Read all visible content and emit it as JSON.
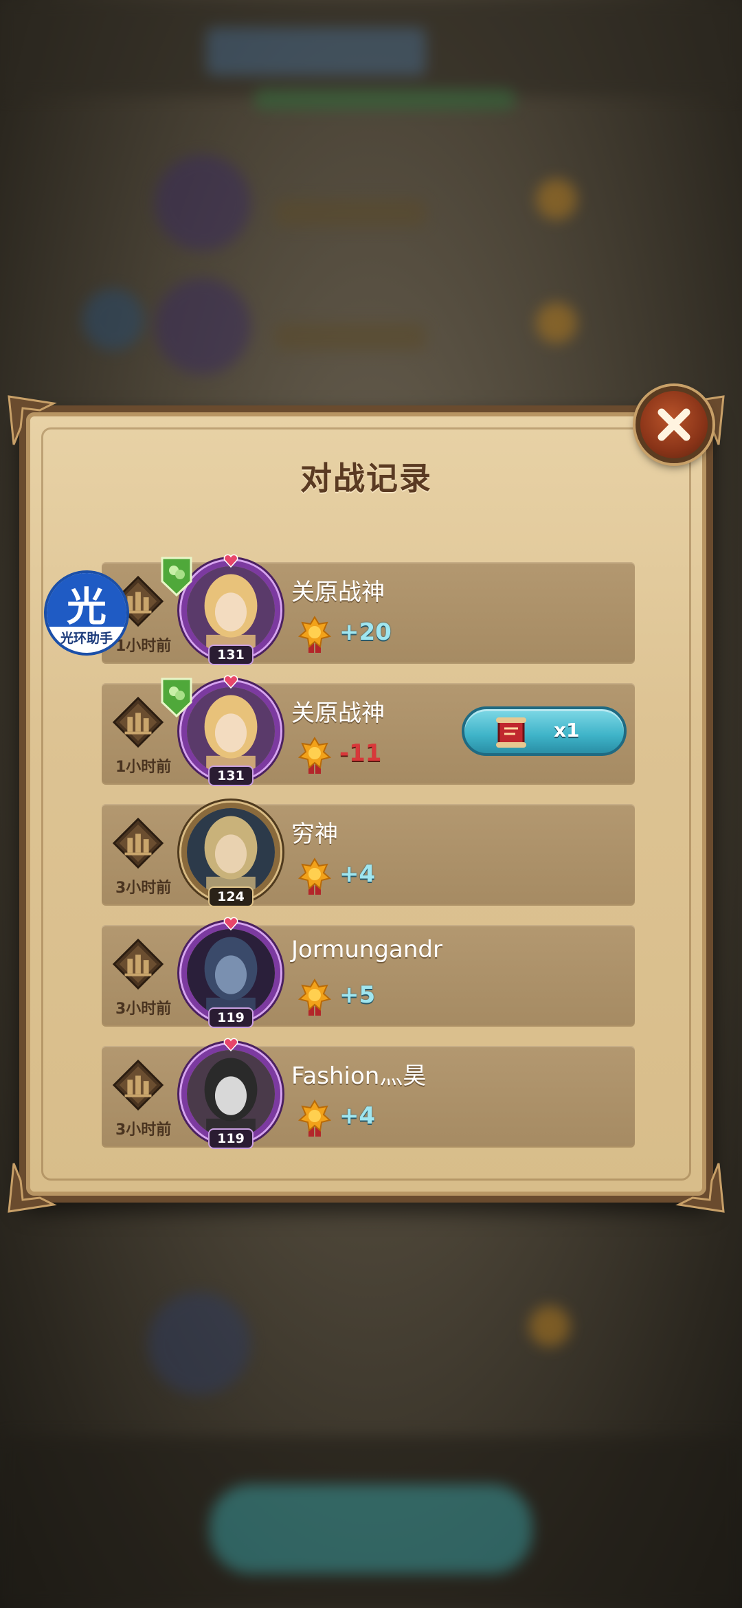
{
  "panel": {
    "title": "对战记录"
  },
  "records": [
    {
      "name": "关原战神",
      "score": "+20",
      "score_type": "positive",
      "time": "1小时前",
      "level": "131",
      "frame": "purple",
      "shield": true
    },
    {
      "name": "关原战神",
      "score": "-11",
      "score_type": "negative",
      "time": "1小时前",
      "level": "131",
      "frame": "purple",
      "shield": true,
      "item_count": "x1"
    },
    {
      "name": "穷神",
      "score": "+4",
      "score_type": "positive",
      "time": "3小时前",
      "level": "124",
      "frame": "brown",
      "shield": false
    },
    {
      "name": "Jormungandr",
      "score": "+5",
      "score_type": "positive",
      "time": "3小时前",
      "level": "119",
      "frame": "purple",
      "shield": false
    },
    {
      "name": "Fashion灬昊",
      "score": "+4",
      "score_type": "positive",
      "time": "3小时前",
      "level": "119",
      "frame": "purple",
      "shield": false
    }
  ],
  "watermark": {
    "char": "光",
    "text": "光环助手"
  },
  "icons": {
    "close": "close-icon",
    "rank": "rank-chart-icon",
    "medal": "trophy-medal-icon",
    "shield": "shield-badge-icon",
    "item": "scroll-item-icon"
  },
  "colors": {
    "positive_score": "#9fe6f0",
    "negative_score": "#d8383a",
    "panel_bg": "#ddc393",
    "item_pill": "#3eb3c8"
  }
}
